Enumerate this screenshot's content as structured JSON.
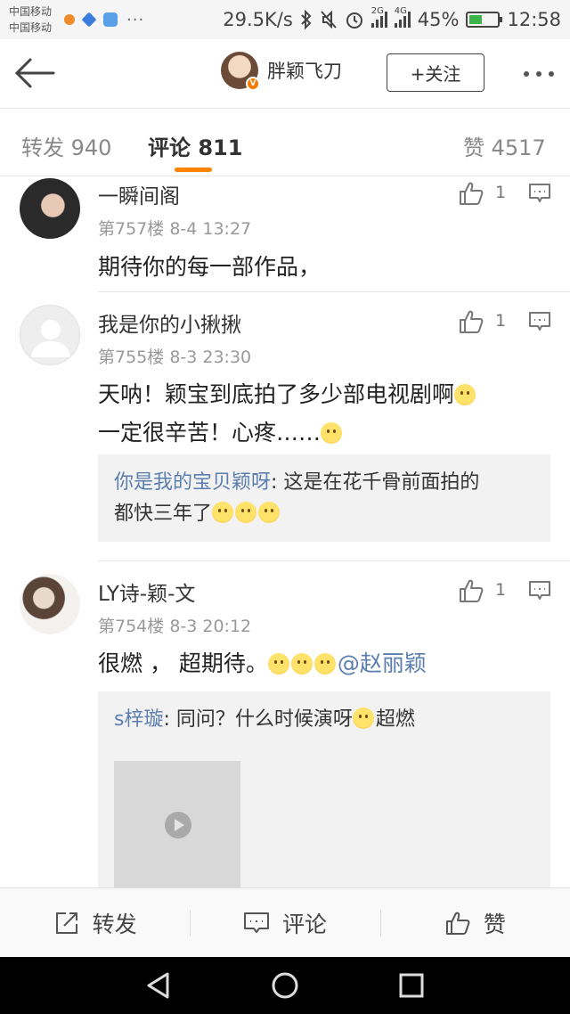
{
  "status_bar": {
    "carrier_1": "中国移动",
    "carrier_2": "中国移动",
    "net_speed": "29.5K/s",
    "net_2g": "2G",
    "net_4g": "4G",
    "battery": "45%",
    "battery_level": 0.45,
    "time": "12:58"
  },
  "nav": {
    "profile_name": "胖颖飞刀",
    "follow_label": "+关注"
  },
  "tabs": {
    "repost_label": "转发",
    "repost_count": "940",
    "comment_label": "评论",
    "comment_count": "811",
    "like_label": "赞",
    "like_count": "4517"
  },
  "comments": [
    {
      "name": "一瞬间阁",
      "floor": "第757楼",
      "time": "8-4 13:27",
      "text": "期待你的每一部作品，",
      "likes": "1"
    },
    {
      "name": "我是你的小揪揪",
      "floor": "第755楼",
      "time": "8-3 23:30",
      "text_line1": "天呐！颖宝到底拍了多少部电视剧啊",
      "text_line2": "一定很辛苦！心疼……",
      "likes": "1",
      "reply": {
        "name": "你是我的宝贝颖呀",
        "text_line1": ": 这是在花千骨前面拍的",
        "text_line2": "都快三年了"
      }
    },
    {
      "name": "LY诗-颖-文",
      "floor": "第754楼",
      "time": "8-3 20:12",
      "text": "很燃 ， 超期待。",
      "mention": "@赵丽颖",
      "likes": "1",
      "reply": {
        "name": "s梓璇",
        "text_before": ": 同问？什么时候演呀",
        "text_after": "超燃"
      }
    }
  ],
  "action_bar": {
    "repost": "转发",
    "comment": "评论",
    "like": "赞"
  }
}
